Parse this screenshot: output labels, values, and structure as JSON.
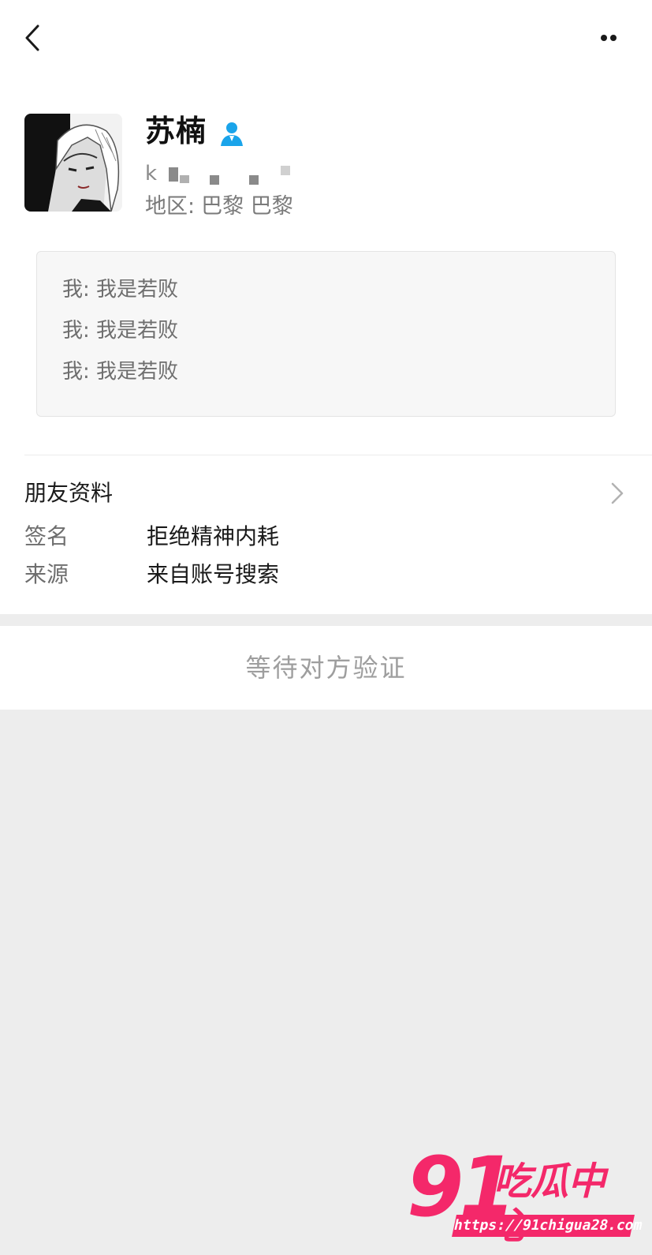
{
  "nav": {
    "back_icon": "chevron-left-icon",
    "more_icon": "more-dots-icon"
  },
  "profile": {
    "name": "苏楠",
    "contact_icon": "contact-person-icon",
    "contact_icon_color": "#1aa4ea",
    "wechat_id_prefix": "k",
    "region_label": "地区:",
    "region_value": "巴黎 巴黎"
  },
  "verification_messages": [
    "我: 我是若败",
    "我: 我是若败",
    "我: 我是若败"
  ],
  "friend_info": {
    "title": "朋友资料",
    "rows": [
      {
        "label": "签名",
        "value": "拒绝精神内耗"
      },
      {
        "label": "来源",
        "value": "来自账号搜索"
      }
    ]
  },
  "pending": {
    "label": "等待对方验证"
  },
  "watermark": {
    "number": "91",
    "name": "吃瓜中心",
    "url": "https://91chigua28.com",
    "color": "#f4286a"
  }
}
